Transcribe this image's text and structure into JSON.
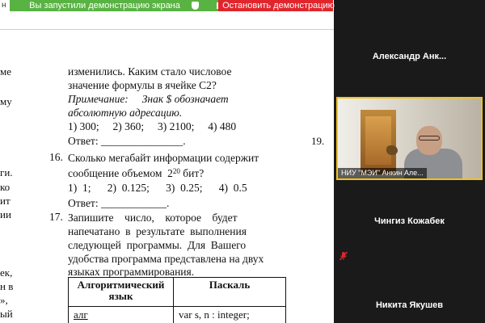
{
  "share_bar": {
    "edge_char": "н",
    "status_label": "Вы запустили демонстрацию экрана",
    "stop_label": "Остановить демонстрацию",
    "status_color": "#59b343",
    "stop_color": "#e0252c"
  },
  "document": {
    "left_fragments": [
      "ме",
      "му",
      "ги.",
      "ко",
      "ит",
      "ии",
      "ек,",
      "н в",
      "»,",
      "ый"
    ],
    "right_number": "19.",
    "q15": {
      "line1": "изменились. Каким стало числовое",
      "line2": "значение формулы в ячейке С2?",
      "note_label": "Примечание:",
      "note_text": "Знак $ обозначает",
      "note_line2": "абсолютную адресацию.",
      "options": "1) 300;     2) 360;     3) 2100;     4) 480",
      "answer": "Ответ: _______________."
    },
    "q16": {
      "number": "16.",
      "line1": "Сколько мегабайт информации содержит",
      "line2_pre": "сообщение объемом  2",
      "line2_sup": "20",
      "line2_post": " бит?",
      "options": "1)  1;      2)  0.125;      3)  0.25;      4)  0.5",
      "answer": "Ответ: ____________."
    },
    "q17": {
      "number": "17.",
      "line1": "Запишите    число,    которое    будет",
      "line2": "напечатано  в  результате  выполнения",
      "line3": "следующей  программы.  Для  Вашего",
      "line4": "удобства программа представлена на двух",
      "line5": "языках программирования.",
      "table": {
        "header_alg": "Алгоритмический язык",
        "header_pascal": "Паскаль",
        "row_alg": "алг",
        "row_pascal": "var s, n : integer;"
      }
    }
  },
  "participants": [
    {
      "name": "Александр  Анк..."
    },
    {
      "video_caption": "НИУ \"МЭИ\" Анкин Але..."
    },
    {
      "name": "Чингиз Кожабек"
    },
    {
      "name": "Никита Якушев"
    }
  ],
  "icons": {
    "shield": "shield-icon",
    "stop": "stop-square-icon",
    "mute": "mic-muted-icon"
  }
}
